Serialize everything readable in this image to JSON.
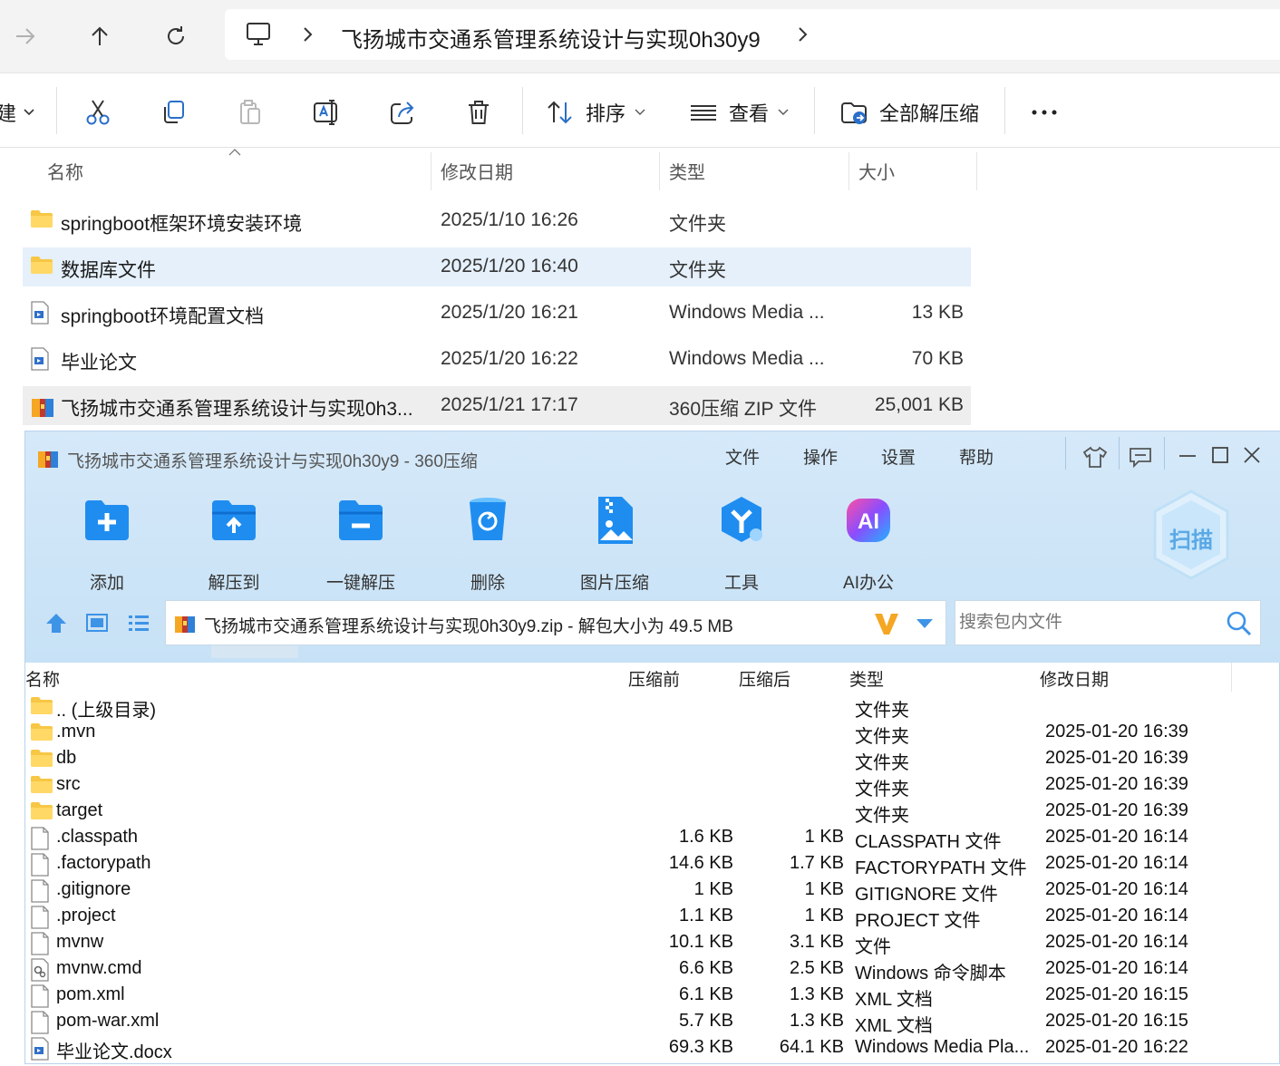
{
  "explorer": {
    "address_path": "飞扬城市交通系管理系统设计与实现0h30y9",
    "new_label_partial": "建",
    "commands": {
      "sort_label": "排序",
      "view_label": "查看",
      "extract_all_label": "全部解压缩"
    },
    "columns": {
      "name": "名称",
      "date": "修改日期",
      "type": "类型",
      "size": "大小"
    },
    "rows": [
      {
        "name": "springboot框架环境安装环境",
        "date": "2025/1/10 16:26",
        "type": "文件夹",
        "size": "",
        "icon": "folder-icon"
      },
      {
        "name": "数据库文件",
        "date": "2025/1/20 16:40",
        "type": "文件夹",
        "size": "",
        "icon": "folder-icon"
      },
      {
        "name": "springboot环境配置文档",
        "date": "2025/1/20 16:21",
        "type": "Windows Media ...",
        "size": "13 KB",
        "icon": "document-icon"
      },
      {
        "name": "毕业论文",
        "date": "2025/1/20 16:22",
        "type": "Windows Media ...",
        "size": "70 KB",
        "icon": "document-icon"
      },
      {
        "name": "飞扬城市交通系管理系统设计与实现0h3...",
        "date": "2025/1/21 17:17",
        "type": "360压缩 ZIP 文件",
        "size": "25,001 KB",
        "icon": "zip-archive-icon"
      }
    ]
  },
  "zip": {
    "title": "飞扬城市交通系管理系统设计与实现0h30y9 - 360压缩",
    "menu": [
      "文件",
      "操作",
      "设置",
      "帮助"
    ],
    "toolbar": [
      "添加",
      "解压到",
      "一键解压",
      "删除",
      "图片压缩",
      "工具",
      "AI办公"
    ],
    "scan_label": "扫描",
    "path_text": "飞扬城市交通系管理系统设计与实现0h30y9.zip - 解包大小为 49.5 MB",
    "search_placeholder": "搜索包内文件",
    "columns": {
      "name": "名称",
      "before": "压缩前",
      "after": "压缩后",
      "type": "类型",
      "date": "修改日期"
    },
    "rows": [
      {
        "name": ".. (上级目录)",
        "before": "",
        "after": "",
        "type": "文件夹",
        "date": "",
        "icon": "folder-icon"
      },
      {
        "name": ".mvn",
        "before": "",
        "after": "",
        "type": "文件夹",
        "date": "2025-01-20 16:39",
        "icon": "folder-icon"
      },
      {
        "name": "db",
        "before": "",
        "after": "",
        "type": "文件夹",
        "date": "2025-01-20 16:39",
        "icon": "folder-icon"
      },
      {
        "name": "src",
        "before": "",
        "after": "",
        "type": "文件夹",
        "date": "2025-01-20 16:39",
        "icon": "folder-icon"
      },
      {
        "name": "target",
        "before": "",
        "after": "",
        "type": "文件夹",
        "date": "2025-01-20 16:39",
        "icon": "folder-icon"
      },
      {
        "name": ".classpath",
        "before": "1.6 KB",
        "after": "1 KB",
        "type": "CLASSPATH 文件",
        "date": "2025-01-20 16:14",
        "icon": "file-icon"
      },
      {
        "name": ".factorypath",
        "before": "14.6 KB",
        "after": "1.7 KB",
        "type": "FACTORYPATH 文件",
        "date": "2025-01-20 16:14",
        "icon": "file-icon"
      },
      {
        "name": ".gitignore",
        "before": "1 KB",
        "after": "1 KB",
        "type": "GITIGNORE 文件",
        "date": "2025-01-20 16:14",
        "icon": "file-icon"
      },
      {
        "name": ".project",
        "before": "1.1 KB",
        "after": "1 KB",
        "type": "PROJECT 文件",
        "date": "2025-01-20 16:14",
        "icon": "file-icon"
      },
      {
        "name": "mvnw",
        "before": "10.1 KB",
        "after": "3.1 KB",
        "type": "文件",
        "date": "2025-01-20 16:14",
        "icon": "file-icon"
      },
      {
        "name": "mvnw.cmd",
        "before": "6.6 KB",
        "after": "2.5 KB",
        "type": "Windows 命令脚本",
        "date": "2025-01-20 16:14",
        "icon": "script-icon"
      },
      {
        "name": "pom.xml",
        "before": "6.1 KB",
        "after": "1.3 KB",
        "type": "XML 文档",
        "date": "2025-01-20 16:15",
        "icon": "file-icon"
      },
      {
        "name": "pom-war.xml",
        "before": "5.7 KB",
        "after": "1.3 KB",
        "type": "XML 文档",
        "date": "2025-01-20 16:15",
        "icon": "file-icon"
      },
      {
        "name": "毕业论文.docx",
        "before": "69.3 KB",
        "after": "64.1 KB",
        "type": "Windows Media Pla...",
        "date": "2025-01-20 16:22",
        "icon": "document-icon"
      }
    ]
  }
}
